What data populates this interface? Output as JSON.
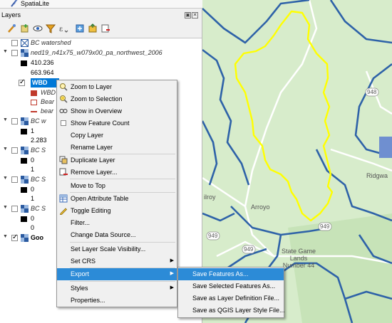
{
  "header": {
    "spatialite_label": "SpatiaLite"
  },
  "panel": {
    "title": "Layers",
    "float_label": "▣",
    "close_label": "✕"
  },
  "layers": [
    {
      "label": "BC watershed",
      "style": "italic"
    },
    {
      "label": "ned19_n41x75_w079x00_pa_northwest_2006",
      "style": "italic"
    },
    {
      "label": "410.236"
    },
    {
      "label": "663.964"
    },
    {
      "label": "WBD",
      "style": "bold-selected"
    },
    {
      "label": "WBD"
    },
    {
      "label": "Bear"
    },
    {
      "label": "bear"
    },
    {
      "label": "BC w"
    },
    {
      "label": "1"
    },
    {
      "label": "2.283"
    },
    {
      "label": "BC S"
    },
    {
      "label": "0"
    },
    {
      "label": "1"
    },
    {
      "label": "BC S"
    },
    {
      "label": "0"
    },
    {
      "label": "1"
    },
    {
      "label": "BC S"
    },
    {
      "label": "0"
    },
    {
      "label": "0"
    },
    {
      "label": "Goo"
    }
  ],
  "context_menu": {
    "items": [
      {
        "label": "Zoom to Layer",
        "icon": "zoom-layer-icon"
      },
      {
        "label": "Zoom to Selection",
        "icon": "zoom-selection-icon"
      },
      {
        "label": "Show in Overview",
        "icon": "overview-icon"
      },
      {
        "label": "Show Feature Count",
        "icon": "checkbox"
      },
      {
        "label": "Copy Layer"
      },
      {
        "label": "Rename Layer"
      },
      {
        "label": "Duplicate Layer",
        "icon": "duplicate-icon"
      },
      {
        "label": "Remove Layer...",
        "icon": "remove-icon"
      },
      {
        "label": "Move to Top"
      },
      {
        "label": "Open Attribute Table",
        "icon": "table-icon"
      },
      {
        "label": "Toggle Editing",
        "icon": "pencil-icon"
      },
      {
        "label": "Filter..."
      },
      {
        "label": "Change Data Source..."
      },
      {
        "label": "Set Layer Scale Visibility..."
      },
      {
        "label": "Set CRS"
      },
      {
        "label": "Export"
      },
      {
        "label": "Styles"
      },
      {
        "label": "Properties..."
      }
    ]
  },
  "export_submenu": {
    "items": [
      {
        "label": "Save Features As..."
      },
      {
        "label": "Save Selected Features As..."
      },
      {
        "label": "Save as Layer Definition File..."
      },
      {
        "label": "Save as QGIS Layer Style File..."
      }
    ]
  },
  "map": {
    "labels": {
      "arroyo": "Arroyo",
      "gilroy": "ilroy",
      "ridgway": "Ridgwa",
      "gamelands": "State Game\nLands\nNumber 44",
      "r948": "948",
      "r949a": "949",
      "r949b": "949",
      "r949c": "949",
      "r949d": "949"
    },
    "colors": {
      "land": "#d7eccb",
      "river": "#2e62a8",
      "road": "#ffffff",
      "boundary": "#ffff00",
      "forest": "#c2e0b2"
    }
  }
}
